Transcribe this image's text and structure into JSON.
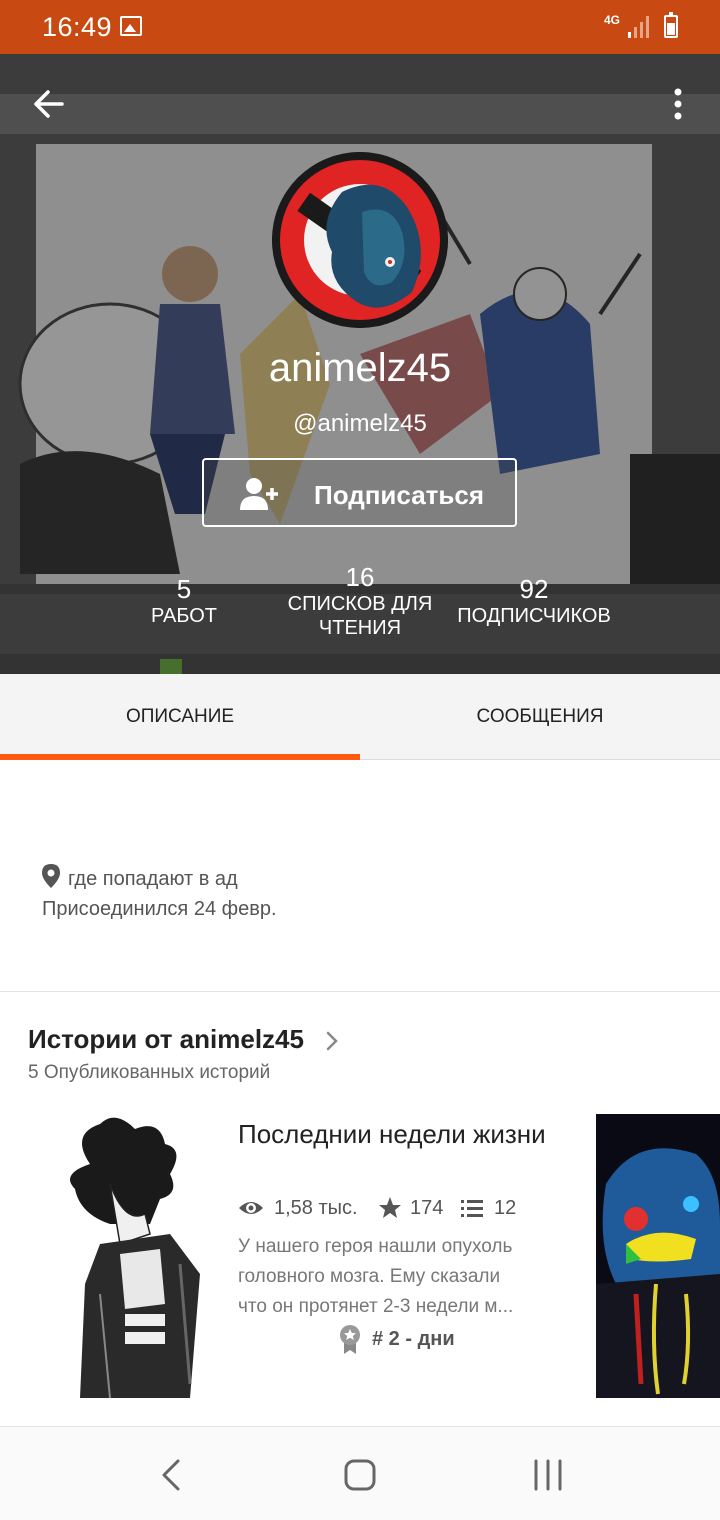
{
  "status_bar": {
    "time": "16:49",
    "network": "4G"
  },
  "profile": {
    "display_name": "animelz45",
    "handle": "@animelz45",
    "follow_label": "Подписаться",
    "stats": [
      {
        "num": "5",
        "lbl": "РАБОТ"
      },
      {
        "num": "16",
        "lbl": "СПИСКОВ ДЛЯ ЧТЕНИЯ"
      },
      {
        "num": "92",
        "lbl": "ПОДПИСЧИКОВ"
      }
    ]
  },
  "tabs": [
    {
      "label": "ОПИСАНИЕ",
      "active": true
    },
    {
      "label": "СООБЩЕНИЯ",
      "active": false
    }
  ],
  "about": {
    "location": "где попадают в ад",
    "joined": "Присоединился 24 февр."
  },
  "stories": {
    "title": "Истории от animelz45",
    "subtitle": "5 Опубликованных историй",
    "items": [
      {
        "title": "Последнии недели жизни",
        "reads": "1,58 тыс.",
        "votes": "174",
        "parts": "12",
        "desc_lines": [
          "У нашего героя нашли опухоль",
          "головного мозга. Ему сказали",
          "что он протянет 2-3 недели м..."
        ],
        "rank": "# 2 - дни"
      }
    ]
  },
  "colors": {
    "accent": "#ff5a10",
    "status_bar": "#c84a12"
  },
  "icons": [
    "back-arrow-icon",
    "more-vert-icon",
    "add-person-icon",
    "location-pin-icon",
    "chevron-right-icon",
    "eye-icon",
    "star-icon",
    "list-icon",
    "rank-badge-icon",
    "nav-back-icon",
    "nav-home-icon",
    "nav-recents-icon"
  ]
}
